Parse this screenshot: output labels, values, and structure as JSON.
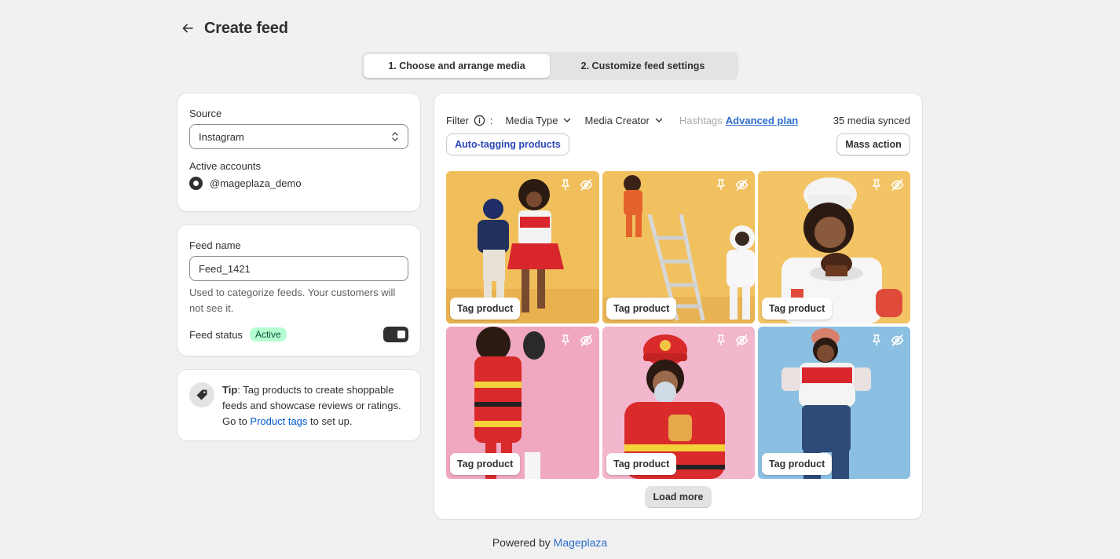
{
  "header": {
    "title": "Create feed"
  },
  "steps": [
    {
      "label": "1. Choose and arrange media",
      "active": true
    },
    {
      "label": "2. Customize feed settings",
      "active": false
    }
  ],
  "source": {
    "label": "Source",
    "value": "Instagram",
    "accounts_label": "Active accounts",
    "account": "@mageplaza_demo"
  },
  "feed": {
    "name_label": "Feed name",
    "name_value": "Feed_1421",
    "help": "Used to categorize feeds. Your customers will not see it.",
    "status_label": "Feed status",
    "status_badge": "Active"
  },
  "tip": {
    "bold": "Tip",
    "text": ": Tag products to create shoppable feeds and showcase reviews or ratings. Go to ",
    "link": "Product tags",
    "after": " to set up."
  },
  "filter": {
    "label": "Filter",
    "colon": ":",
    "media_type": "Media Type",
    "media_creator": "Media Creator",
    "hashtags": "Hashtags",
    "advanced": "Advanced plan",
    "synced": "35 media synced"
  },
  "actions": {
    "auto_tagging": "Auto-tagging products",
    "mass_action": "Mass action",
    "load_more": "Load more"
  },
  "media": [
    {
      "tag_label": "Tag product"
    },
    {
      "tag_label": "Tag product"
    },
    {
      "tag_label": "Tag product"
    },
    {
      "tag_label": "Tag product"
    },
    {
      "tag_label": "Tag product"
    },
    {
      "tag_label": "Tag product"
    }
  ],
  "footer": {
    "text": "Powered by",
    "link": "Mageplaza"
  },
  "colors": {
    "accent_link": "#005bd3",
    "badge_bg": "#b4fed2",
    "yellow_bg": "#f2c45f",
    "pink_bg": "#f0b5cb",
    "blue_bg": "#8fc1e3"
  }
}
